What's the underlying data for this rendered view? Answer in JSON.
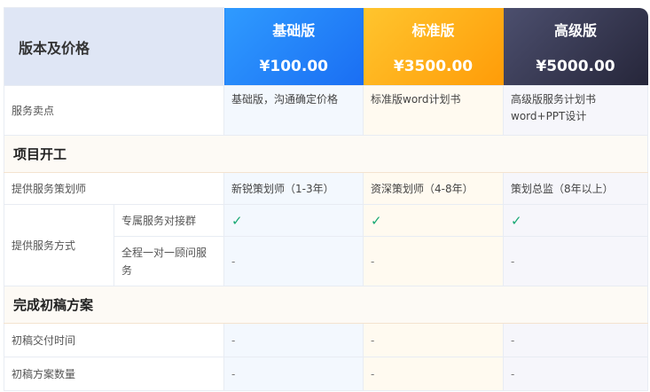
{
  "header": {
    "title": "版本及价格",
    "plans": [
      {
        "name": "基础版",
        "price": "¥100.00"
      },
      {
        "name": "标准版",
        "price": "¥3500.00"
      },
      {
        "name": "高级版",
        "price": "¥5000.00"
      }
    ]
  },
  "selling_point": {
    "label": "服务卖点",
    "values": [
      "基础版，沟通确定价格",
      "标准版word计划书",
      "高级版服务计划书\nword+PPT设计"
    ]
  },
  "sections": {
    "start": "项目开工",
    "draft": "完成初稿方案"
  },
  "planner": {
    "label": "提供服务策划师",
    "values": [
      "新锐策划师（1-3年）",
      "资深策划师（4-8年）",
      "策划总监（8年以上）"
    ]
  },
  "service_mode": {
    "label": "提供服务方式",
    "rows": [
      {
        "label": "专属服务对接群",
        "values": [
          "✓",
          "✓",
          "✓"
        ]
      },
      {
        "label": "全程一对一顾问服务",
        "values": [
          "-",
          "-",
          "-"
        ]
      }
    ]
  },
  "draft_rows": [
    {
      "label": "初稿交付时间",
      "values": [
        "-",
        "-",
        "-"
      ]
    },
    {
      "label": "初稿方案数量",
      "values": [
        "-",
        "-",
        "-"
      ]
    }
  ],
  "colors": {
    "basic": "#1a6ef3",
    "standard": "#ff9c08",
    "advanced": "#26263a",
    "check": "#19a974"
  }
}
